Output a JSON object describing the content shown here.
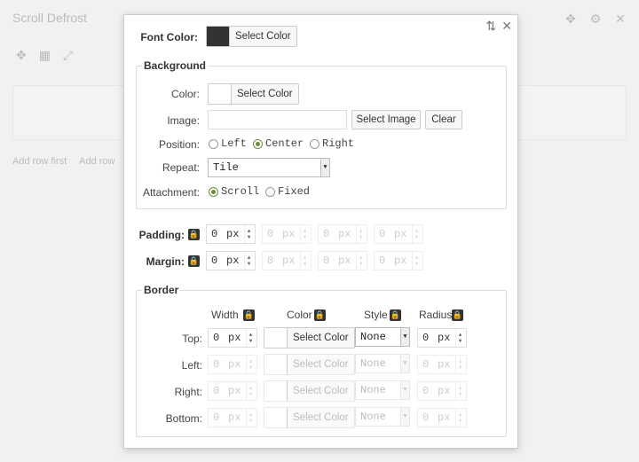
{
  "background_ui": {
    "title": "Scroll Defrost",
    "toolbar_icons": [
      "move-icon",
      "gear-icon",
      "close-icon"
    ],
    "links": [
      "Add row first",
      "Add row"
    ]
  },
  "modal": {
    "controls": {
      "swap": "⇅",
      "close": "✕"
    },
    "font_color": {
      "label": "Font Color:",
      "button": "Select Color",
      "swatch": "#333333"
    },
    "background": {
      "legend": "Background",
      "color": {
        "label": "Color:",
        "button": "Select Color"
      },
      "image": {
        "label": "Image:",
        "value": "",
        "select_button": "Select Image",
        "clear_button": "Clear"
      },
      "position": {
        "label": "Position:",
        "options": [
          "Left",
          "Center",
          "Right"
        ],
        "selected": "Center"
      },
      "repeat": {
        "label": "Repeat:",
        "value": "Tile"
      },
      "attachment": {
        "label": "Attachment:",
        "options": [
          "Scroll",
          "Fixed"
        ],
        "selected": "Scroll"
      }
    },
    "padding": {
      "label": "Padding:",
      "values": [
        "0",
        "0",
        "0",
        "0"
      ],
      "unit": "px"
    },
    "margin": {
      "label": "Margin:",
      "values": [
        "0",
        "0",
        "0",
        "0"
      ],
      "unit": "px"
    },
    "border": {
      "legend": "Border",
      "headers": {
        "width": "Width",
        "color": "Color",
        "style": "Style",
        "radius": "Radius"
      },
      "rows": [
        {
          "label": "Top:",
          "width": "0",
          "unit": "px",
          "color_button": "Select Color",
          "style": "None",
          "radius": "0"
        },
        {
          "label": "Left:",
          "width": "0",
          "unit": "px",
          "color_button": "Select Color",
          "style": "None",
          "radius": "0"
        },
        {
          "label": "Right:",
          "width": "0",
          "unit": "px",
          "color_button": "Select Color",
          "style": "None",
          "radius": "0"
        },
        {
          "label": "Bottom:",
          "width": "0",
          "unit": "px",
          "color_button": "Select Color",
          "style": "None",
          "radius": "0"
        }
      ]
    }
  },
  "colors": {
    "accent_radio": "#6a8f3a",
    "lock": "#333333"
  }
}
